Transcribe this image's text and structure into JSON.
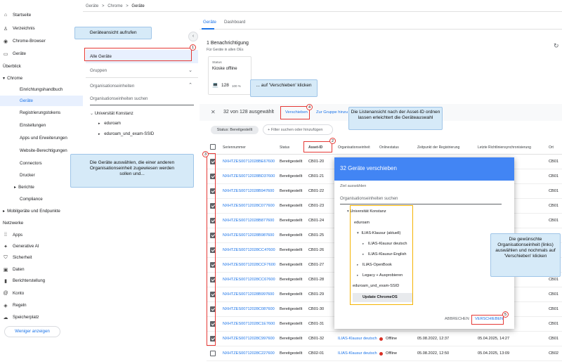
{
  "breadcrumb": {
    "a": "Geräte",
    "sep1": ">",
    "b": "Chrome",
    "sep2": ">",
    "c": "Geräte"
  },
  "nav": {
    "startseite": "Startseite",
    "verzeichnis": "Verzeichnis",
    "chrome_browser": "Chrome-Browser",
    "geraete": "Geräte",
    "ueberblick": "Überblick",
    "chrome": "Chrome",
    "einrichtung": "Einrichtungshandbuch",
    "geraete_active": "Geräte",
    "registrierung": "Registrierungstokens",
    "einstellungen": "Einstellungen",
    "apps": "Apps und Erweiterungen",
    "website": "Website-Berechtigungen",
    "connectors": "Connectors",
    "drucker": "Drucker",
    "berichte": "Berichte",
    "compliance": "Compliance",
    "mobil": "Mobilgeräte und Endpunkte",
    "netzwerke": "Netzwerke",
    "apps2": "Apps",
    "genai": "Generative AI",
    "sicherheit": "Sicherheit",
    "daten": "Daten",
    "berichterstellung": "Berichterstellung",
    "konto": "Konto",
    "regeln": "Regeln",
    "speicherplatz": "Speicherplatz",
    "weniger": "Weniger anzeigen"
  },
  "left": {
    "alle": "Alle Geräte",
    "gruppen": "Gruppen",
    "org": "Organisationseinheiten",
    "search_ph": "Organisationseinheiten suchen",
    "uni": "Universität Konstanz",
    "eduroam": "eduroam",
    "eduroam_ssid": "eduroam_und_exam-SSID"
  },
  "tabs": {
    "geraete": "Geräte",
    "dashboard": "Dashboard"
  },
  "notif": {
    "title": "1 Benachrichtigung",
    "sub": "Für Geräte in allen OEs",
    "status": "Status",
    "kiosk": "Kioske offline",
    "count": "128",
    "pct": "100 %"
  },
  "selbar": {
    "close": "✕",
    "count": "32 von 128 ausgewählt",
    "verschieben": "Verschieben",
    "gruppe": "Zur Gruppe hinzu"
  },
  "filter": {
    "chip": "Status: Bereitgestellt",
    "add": "+ Filter suchen oder hinzufügen"
  },
  "table": {
    "headers": {
      "sn": "Seriennummer",
      "status": "Status",
      "asset": "Asset-ID",
      "org": "Organisationseinheit",
      "online": "Onlinestatus",
      "reg": "Zeitpunkt der Registrierung",
      "sync": "Letzte Richtliniensynchronisierung",
      "ort": "Ort"
    },
    "rows": [
      {
        "sn": "NXHTZES00712028BE67600",
        "st": "Bereitgestellt",
        "asset": "CB01-20",
        "ort": "CB01"
      },
      {
        "sn": "NXHTZES00712028BD37600",
        "st": "Bereitgestellt",
        "asset": "CB01-21",
        "ort": "CB01"
      },
      {
        "sn": "NXHTZES00712028B947600",
        "st": "Bereitgestellt",
        "asset": "CB01-22",
        "ort": "CB01"
      },
      {
        "sn": "NXHTZES00712028C077600",
        "st": "Bereitgestellt",
        "asset": "CB01-23",
        "ort": "CB01"
      },
      {
        "sn": "NXHTZES00712028B877600",
        "st": "Bereitgestellt",
        "asset": "CB01-24",
        "ort": "CB01"
      },
      {
        "sn": "NXHTZES00712028B987600",
        "st": "Bereitgestellt",
        "asset": "CB01-25",
        "ort": "CB01"
      },
      {
        "sn": "NXHTZES00712028CC47600",
        "st": "Bereitgestellt",
        "asset": "CB01-26",
        "ort": "CB01"
      },
      {
        "sn": "NXHTZES00712028CCF7600",
        "st": "Bereitgestellt",
        "asset": "CB01-27",
        "ort": "CB01"
      },
      {
        "sn": "NXHTZES00712028CC67600",
        "st": "Bereitgestellt",
        "asset": "CB01-28",
        "ort": "CB01"
      },
      {
        "sn": "NXHTZES00712028B997600",
        "st": "Bereitgestellt",
        "asset": "CB01-29",
        "ort": "CB01"
      },
      {
        "sn": "NXHTZES00712028C087600",
        "st": "Bereitgestellt",
        "asset": "CB01-30",
        "ort": "CB01"
      },
      {
        "sn": "NXHTZES00712028C1E7600",
        "st": "Bereitgestellt",
        "asset": "CB01-31",
        "ort": "CB01"
      },
      {
        "sn": "NXHTZES00712028C997600",
        "st": "Bereitgestellt",
        "asset": "CB01-32",
        "org": "ILIAS-Klausur deutsch",
        "online": "Offline",
        "reg": "05.08.2022, 12:37",
        "sync": "05.04.2025, 14:27",
        "ort": "CB01"
      },
      {
        "sn": "NXHTZES00712028C227600",
        "st": "Bereitgestellt",
        "asset": "CB02-01",
        "org": "ILIAS-Klausur deutsch",
        "online": "Offline",
        "reg": "05.08.2022, 12:50",
        "sync": "05.04.2025, 13:09",
        "ort": "CB02"
      }
    ]
  },
  "dialog": {
    "title": "32 Geräte verschieben",
    "ziel": "Ziel auswählen",
    "search_ph": "Organisationseinheiten suchen",
    "uni": "Universität Konstanz",
    "eduroam": "eduroam",
    "ilias_aktuell": "ILIAS-Klausur (aktuell)",
    "ilias_de": "ILIAS-Klausur deutsch",
    "ilias_en": "ILIAS-Klausur-English",
    "openbook": "ILIAS-OpenBook",
    "legacy": "Legacy + Ausprobieren",
    "eduroam_ssid": "eduroam_und_exam-SSID",
    "update": "Update ChromeOS",
    "abbrechen": "ABBRECHEN",
    "verschieben": "VERSCHIEBEN"
  },
  "callouts": {
    "c1": "Geräteansicht aufrufen",
    "c2": "... auf 'Verschieben' klicken",
    "c3": "Die Listenansicht nach der Asset-ID ordnen lassen erleichtert die Geräteauswahl",
    "c4": "Die Geräte auswählen, die einer anderen Organisationseinheit zugewiesen werden sollen und...",
    "c5": "Die gewünschte Organisationseinheit (links) auswählen und nochmals auf 'Verschieben' klicken"
  },
  "badges": {
    "b1": "1",
    "b2": "2",
    "b3": "3",
    "b4": "4",
    "b5": "5"
  },
  "colors": {
    "accent": "#1a73e8",
    "callout": "#d6eaf8",
    "red": "#e53935",
    "dialog_header": "#4285f4",
    "yellow": "#f5b301"
  }
}
